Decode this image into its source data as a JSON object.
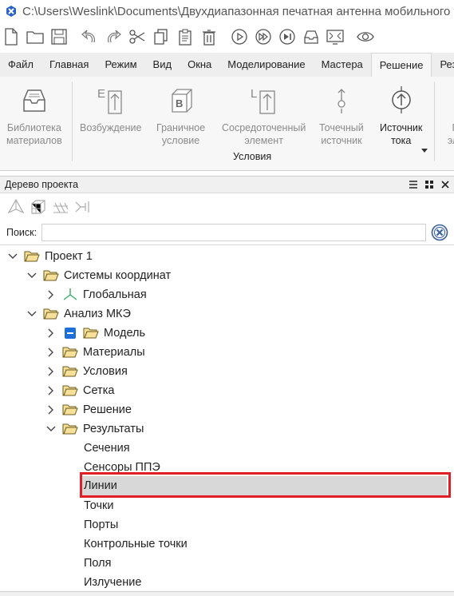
{
  "window": {
    "title": "C:\\Users\\Weslink\\Documents\\Двухдиапазонная печатная антенна мобильного т"
  },
  "menu": {
    "tabs": [
      "Файл",
      "Главная",
      "Режим",
      "Вид",
      "Окна",
      "Моделирование",
      "Мастера",
      "Решение",
      "Рез"
    ],
    "active": "Решение"
  },
  "ribbon": {
    "buttons": {
      "library": "Библиотека\nматериалов",
      "excitation": "Возбуждение",
      "boundary": "Граничное\nусловие",
      "lumped": "Сосредоточенный\nэлемент",
      "point": "Точечный\nисточник",
      "current": "Источник\nтока",
      "partial": "П\nэле"
    },
    "group_label": "Условия"
  },
  "panel": {
    "title": "Дерево проекта"
  },
  "search": {
    "label": "Поиск:",
    "value": ""
  },
  "tree": {
    "project": "Проект 1",
    "coord_systems": "Системы координат",
    "global": "Глобальная",
    "fem": "Анализ МКЭ",
    "model": "Модель",
    "materials": "Материалы",
    "conditions": "Условия",
    "mesh": "Сетка",
    "solution": "Решение",
    "results": "Результаты",
    "sections": "Сечения",
    "sensors": "Сенсоры ППЭ",
    "lines": "Линии",
    "points": "Точки",
    "ports": "Порты",
    "control_points": "Контрольные точки",
    "fields": "Поля",
    "radiation": "Излучение"
  },
  "colors": {
    "highlight": "#e01f26",
    "selected": "#d8d8d8",
    "folder": "#f7e19a",
    "accent": "#1e6fd9"
  }
}
